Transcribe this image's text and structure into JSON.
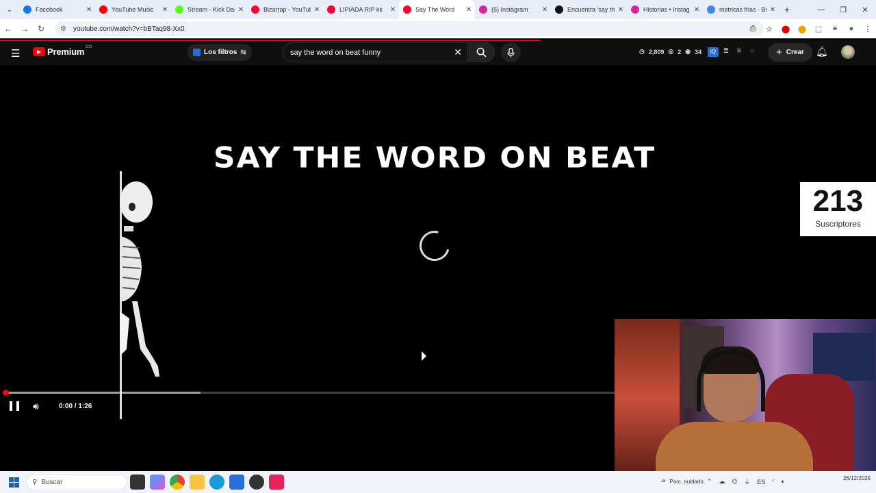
{
  "browser": {
    "tabs": [
      {
        "label": "Facebook",
        "color": "#1877f2",
        "active": false
      },
      {
        "label": "YouTube Music",
        "color": "#ff0000",
        "active": false
      },
      {
        "label": "Stream - Kick Das",
        "color": "#53fc18",
        "active": false
      },
      {
        "label": "Bizarrap - YouTub",
        "color": "#ff0033",
        "active": false
      },
      {
        "label": "LIPIADA RIP kk",
        "color": "#ff0033",
        "active": false
      },
      {
        "label": "Say The Word",
        "color": "#ff0033",
        "active": true
      },
      {
        "label": "(5) Instagram",
        "color": "#d6249f",
        "active": false
      },
      {
        "label": "Encuentra 'say th",
        "color": "#111111",
        "active": false
      },
      {
        "label": "Historias • Instag",
        "color": "#d6249f",
        "active": false
      },
      {
        "label": "metricas frias - Bu",
        "color": "#4285f4",
        "active": false
      }
    ],
    "url": "youtube.com/watch?v=bBTaq98-Xx0"
  },
  "youtube": {
    "logo_text": "Premium",
    "logo_region": "CO",
    "filters_label": "Los filtros",
    "search_value": "say the word on beat funny",
    "stats": {
      "views": "2,809",
      "a": "2",
      "b": "34"
    },
    "create_label": "Crear"
  },
  "player": {
    "video_title_overlay": "SAY THE WORD ON BEAT",
    "time_display": "0:00 / 1:26",
    "buffered_fraction": 0.32,
    "subscriber_count": "213",
    "subscriber_label": "Suscriptores"
  },
  "taskbar": {
    "search_placeholder": "Buscar",
    "weather": "Parc. nublado",
    "lang": "ES",
    "date": "26/12/2025"
  },
  "colors": {
    "accent": "#ff0000",
    "header_bg": "#0f0f0f"
  }
}
